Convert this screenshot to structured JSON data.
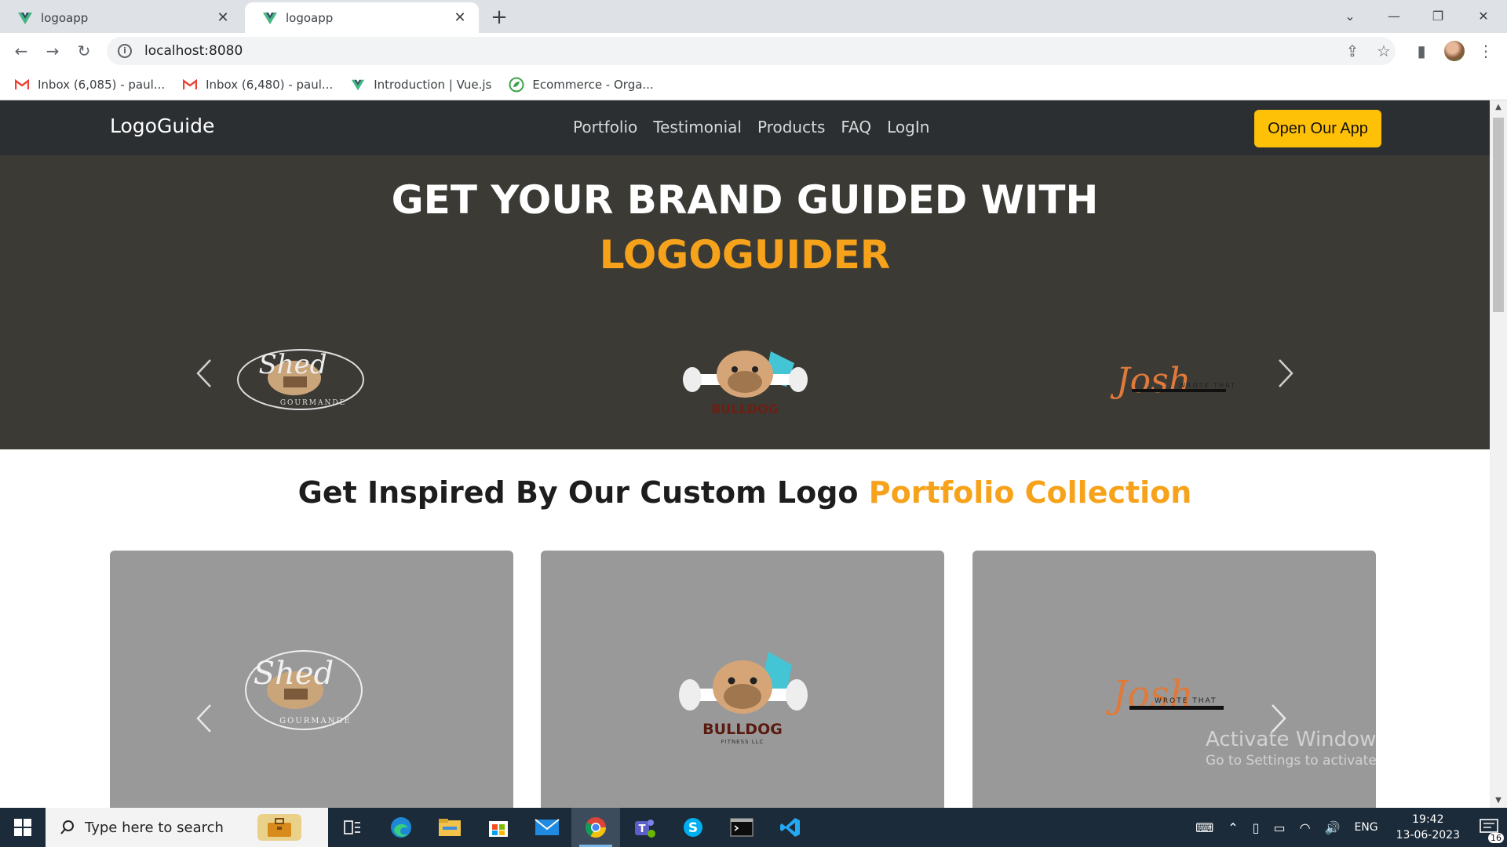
{
  "browser": {
    "tabs": [
      {
        "title": "logoapp",
        "active": false
      },
      {
        "title": "logoapp",
        "active": true
      }
    ],
    "url": "localhost:8080",
    "bookmarks": [
      {
        "label": "Inbox (6,085) - paul...",
        "icon": "gmail-icon"
      },
      {
        "label": "Inbox (6,480) - paul...",
        "icon": "gmail-icon"
      },
      {
        "label": "Introduction | Vue.js",
        "icon": "vue-icon"
      },
      {
        "label": "Ecommerce - Orga...",
        "icon": "leaf-icon"
      }
    ]
  },
  "site": {
    "brand": "LogoGuide",
    "nav": [
      "Portfolio",
      "Testimonial",
      "Products",
      "FAQ",
      "LogIn"
    ],
    "cta": "Open Our App",
    "hero_line1": "GET YOUR BRAND GUIDED WITH",
    "hero_line2": "LOGOGUIDER",
    "section_title_a": "Get Inspired By Our Custom Logo ",
    "section_title_b": "Portfolio Collection",
    "logos": [
      {
        "name": "Shed",
        "subtitle": "GOURMANDE"
      },
      {
        "name": "BULLDOG",
        "subtitle": "FITNESS LLC"
      },
      {
        "name": "Josh",
        "subtitle": "WROTE THAT"
      }
    ]
  },
  "watermark": {
    "title": "Activate Windows",
    "subtitle": "Go to Settings to activate Windows."
  },
  "taskbar": {
    "search_placeholder": "Type here to search",
    "language": "ENG",
    "time": "19:42",
    "date": "13-06-2023",
    "notifications": "16"
  },
  "colors": {
    "accent": "#f7a21b",
    "cta": "#ffc107",
    "navbar": "#2b2f32",
    "hero": "#3b3a35",
    "card": "#999999"
  }
}
